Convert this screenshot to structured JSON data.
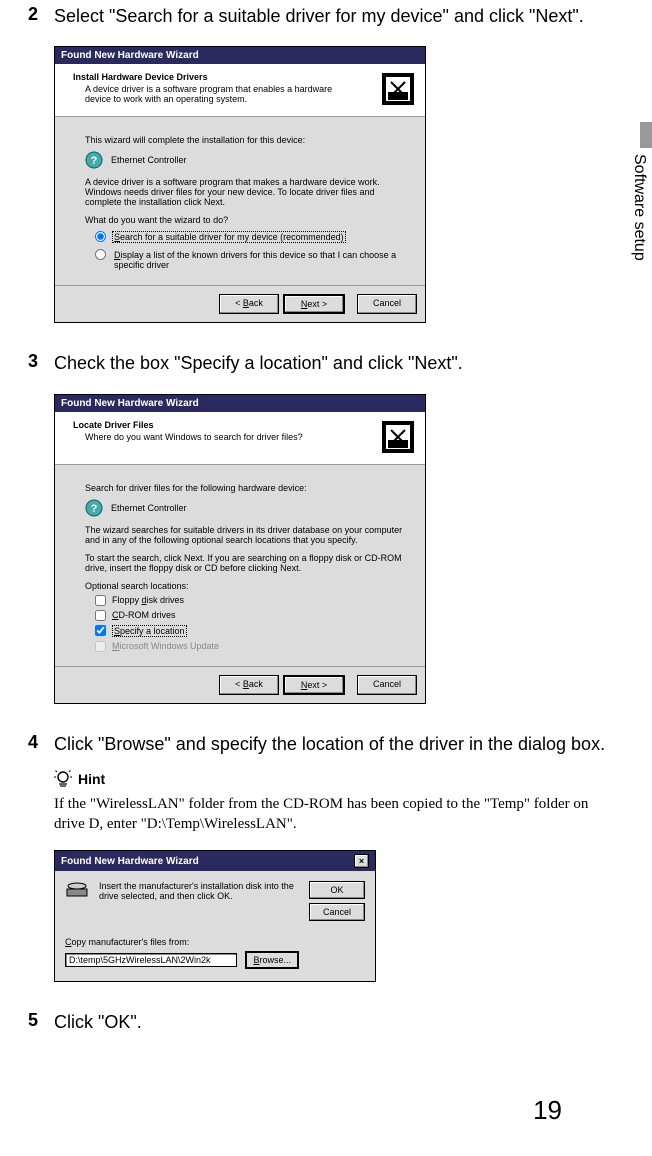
{
  "side_tab": "Software setup",
  "page_number": "19",
  "steps": {
    "s2": {
      "num": "2",
      "text": "Select \"Search for a suitable driver for my device\" and click \"Next\"."
    },
    "s3": {
      "num": "3",
      "text": "Check the box \"Specify a location\" and click \"Next\"."
    },
    "s4": {
      "num": "4",
      "text": "Click \"Browse\" and specify the location of the driver in the dialog box."
    },
    "s5": {
      "num": "5",
      "text": "Click \"OK\"."
    }
  },
  "hint": {
    "label": "Hint",
    "text": "If the \"WirelessLAN\" folder from the CD-ROM has been copied to the \"Temp\" folder on drive D, enter \"D:\\Temp\\WirelessLAN\"."
  },
  "wizard1": {
    "title": "Found New Hardware Wizard",
    "heading": "Install Hardware Device Drivers",
    "subheading": "A device driver is a software program that enables a hardware device to work with an operating system.",
    "line1": "This wizard will complete the installation for this device:",
    "device": "Ethernet Controller",
    "desc": "A device driver is a software program that makes a hardware device work. Windows needs driver files for your new device. To locate driver files and complete the installation click Next.",
    "prompt": "What do you want the wizard to do?",
    "opt1": "Search for a suitable driver for my device (recommended)",
    "opt2": "Display a list of the known drivers for this device so that I can choose a specific driver",
    "back": "< Back",
    "next": "Next >",
    "cancel": "Cancel"
  },
  "wizard2": {
    "title": "Found New Hardware Wizard",
    "heading": "Locate Driver Files",
    "subheading": "Where do you want Windows to search for driver files?",
    "line1": "Search for driver files for the following hardware device:",
    "device": "Ethernet Controller",
    "desc1": "The wizard searches for suitable drivers in its driver database on your computer and in any of the following optional search locations that you specify.",
    "desc2": "To start the search, click Next. If you are searching on a floppy disk or CD-ROM drive, insert the floppy disk or CD before clicking Next.",
    "optlabel": "Optional search locations:",
    "chk1": "Floppy disk drives",
    "chk2": "CD-ROM drives",
    "chk3": "Specify a location",
    "chk4": "Microsoft Windows Update",
    "back": "< Back",
    "next": "Next >",
    "cancel": "Cancel"
  },
  "dialog": {
    "title": "Found New Hardware Wizard",
    "msg": "Insert the manufacturer's installation disk into the drive selected, and then click OK.",
    "copylabel": "Copy manufacturer's files from:",
    "path": "D:\\temp\\5GHzWirelessLAN\\2Win2k",
    "ok": "OK",
    "cancel": "Cancel",
    "browse": "Browse..."
  }
}
